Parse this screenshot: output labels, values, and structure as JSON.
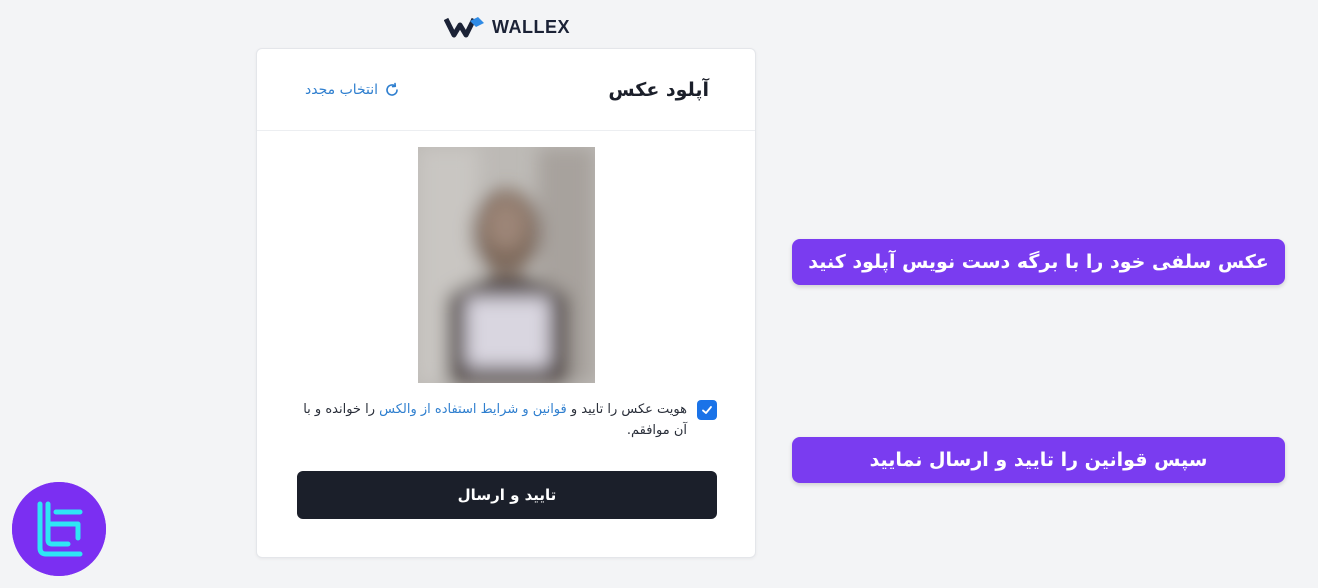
{
  "brand": {
    "logo_text": "WALLEX",
    "accent": "#1a73e8"
  },
  "card": {
    "title": "آپلود عکس",
    "reselect_label": "انتخاب مجدد",
    "reselect_icon": "refresh-icon",
    "consent": {
      "checked": true,
      "text_before": "هویت عکس را تایید و ",
      "link_text": "قوانین و شرایط استفاده از والکس",
      "text_after": " را خوانده و با آن موافقم."
    },
    "submit_label": "تایید و ارسال"
  },
  "annotations": {
    "step1": "عکس سلفی خود را با برگه دست نویس آپلود کنید",
    "step2": "سپس قوانین را تایید و ارسال نمایید",
    "color": "#7a3cf0"
  }
}
